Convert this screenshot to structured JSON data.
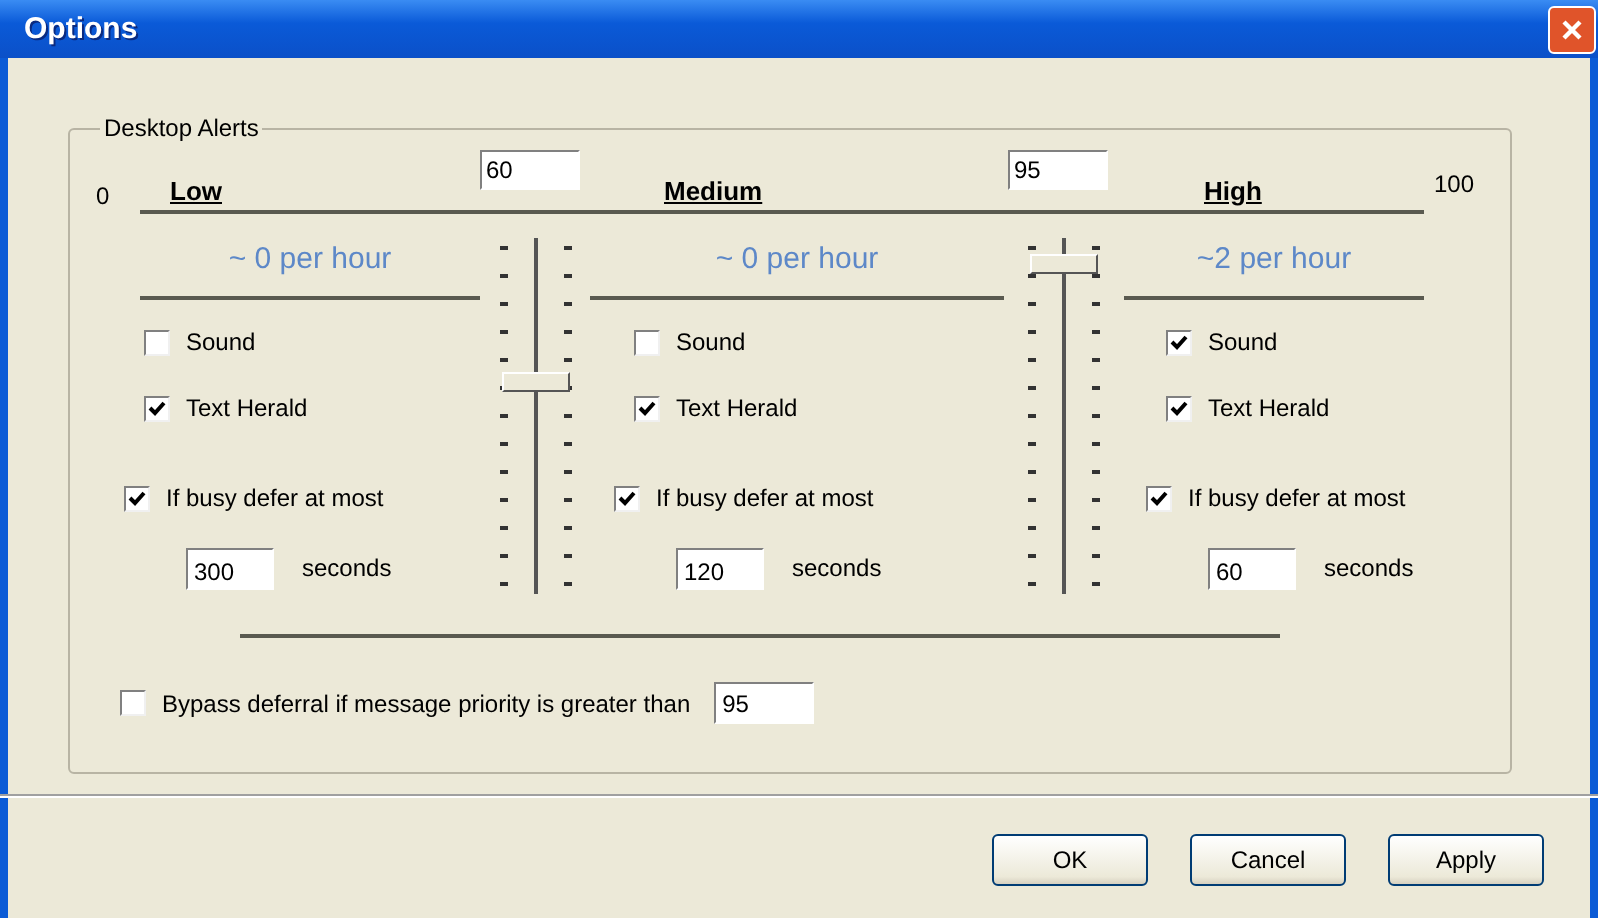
{
  "window": {
    "title": "Options"
  },
  "group": {
    "title": "Desktop Alerts",
    "scale_min": "0",
    "scale_max": "100"
  },
  "levels": [
    {
      "label": "Low",
      "rate": "~ 0 per hour",
      "sound": {
        "label": "Sound",
        "checked": false
      },
      "text_herald": {
        "label": "Text Herald",
        "checked": true
      },
      "defer": {
        "label": "If busy defer at most",
        "checked": true
      },
      "seconds": "300",
      "seconds_unit": "seconds"
    },
    {
      "label": "Medium",
      "rate": "~ 0 per hour",
      "sound": {
        "label": "Sound",
        "checked": false
      },
      "text_herald": {
        "label": "Text Herald",
        "checked": true
      },
      "defer": {
        "label": "If busy defer at most",
        "checked": true
      },
      "seconds": "120",
      "seconds_unit": "seconds"
    },
    {
      "label": "High",
      "rate": "~2 per hour",
      "sound": {
        "label": "Sound",
        "checked": true
      },
      "text_herald": {
        "label": "Text Herald",
        "checked": true
      },
      "defer": {
        "label": "If busy defer at most",
        "checked": true
      },
      "seconds": "60",
      "seconds_unit": "seconds"
    }
  ],
  "thresholds": [
    {
      "value": "60",
      "level": 0.6
    },
    {
      "value": "95",
      "level": 0.95
    }
  ],
  "bypass": {
    "label": "Bypass deferral if message priority is greater than",
    "checked": false,
    "value": "95"
  },
  "buttons": [
    {
      "label": "OK"
    },
    {
      "label": "Cancel"
    },
    {
      "label": "Apply"
    }
  ]
}
